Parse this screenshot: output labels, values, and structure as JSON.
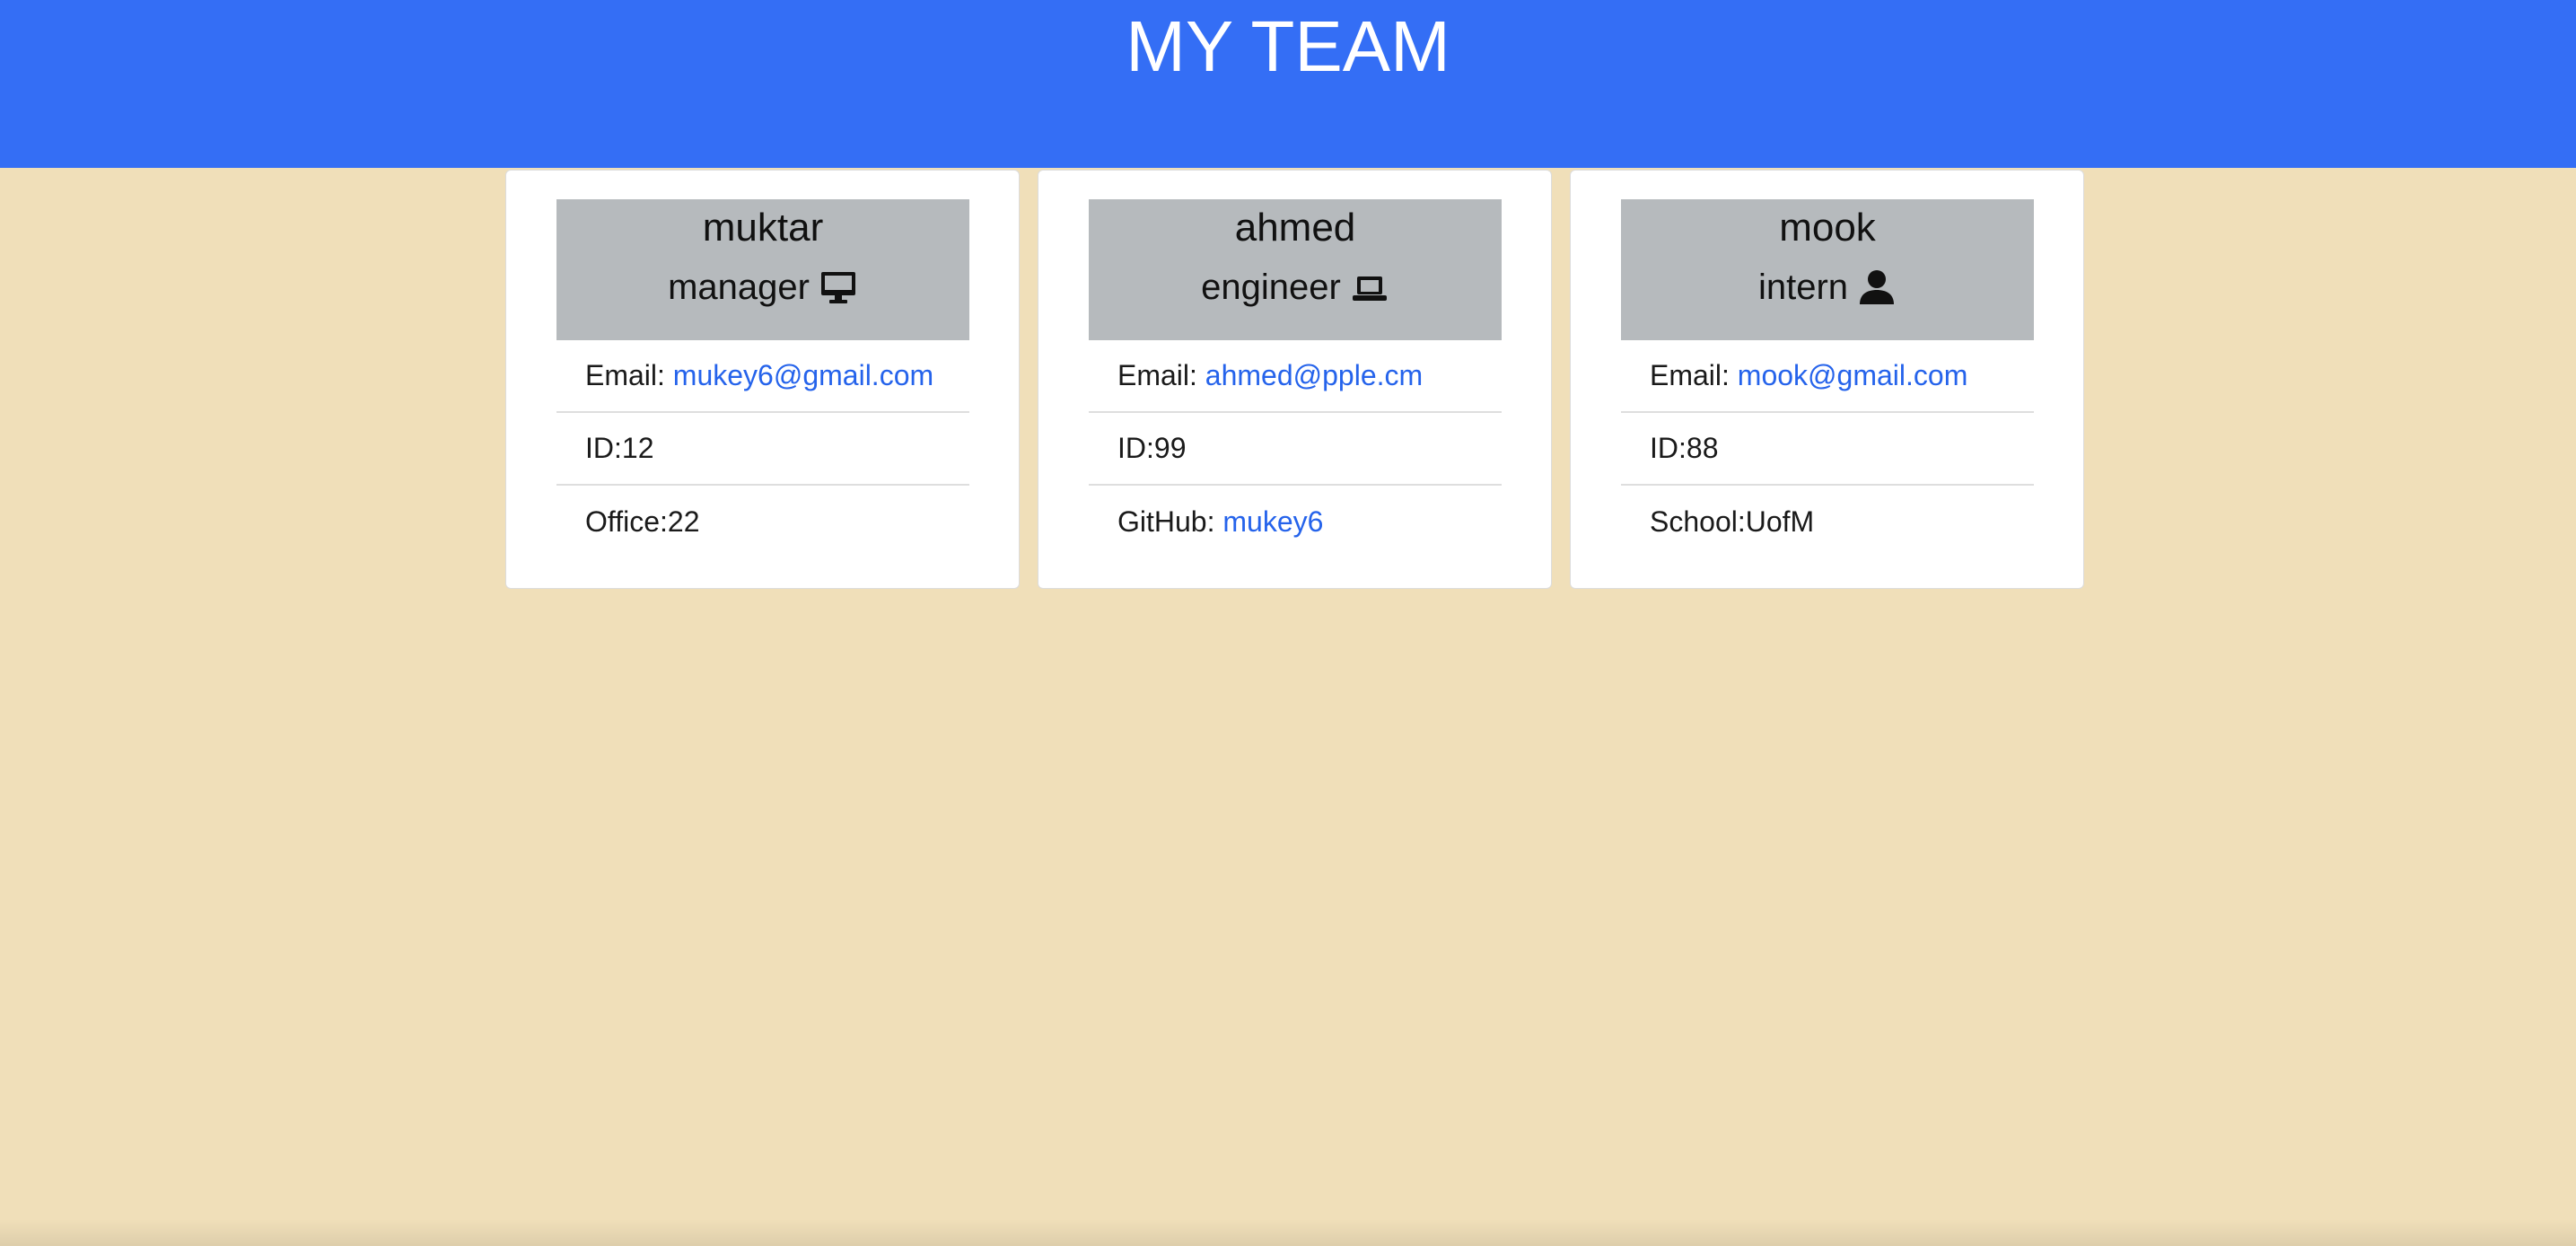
{
  "header": {
    "title": "MY TEAM",
    "background": "#346ef5"
  },
  "colors": {
    "page_background": "#f0dfb9",
    "card_header": "#b6babd",
    "link": "#2563eb"
  },
  "cards": [
    {
      "name": "muktar",
      "role": "manager",
      "role_icon": "desktop-icon",
      "email_label": "Email:",
      "email": "mukey6@gmail.com",
      "id_text": "ID:12",
      "extra_text": "Office:22"
    },
    {
      "name": "ahmed",
      "role": "engineer",
      "role_icon": "laptop-icon",
      "email_label": "Email:",
      "email": "ahmed@pple.cm",
      "id_text": "ID:99",
      "extra_label": "GitHub:",
      "extra_link": "mukey6"
    },
    {
      "name": "mook",
      "role": "intern",
      "role_icon": "user-icon",
      "email_label": "Email:",
      "email": "mook@gmail.com",
      "id_text": "ID:88",
      "extra_text": "School:UofM"
    }
  ]
}
